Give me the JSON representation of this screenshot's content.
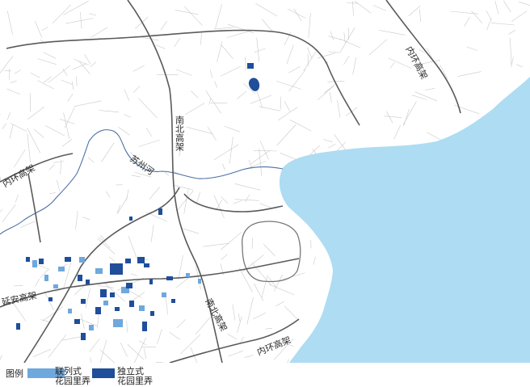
{
  "labels": {
    "inner_ring_ne": "内环高架",
    "inner_ring_w": "内环高架",
    "inner_ring_s": "内环高架",
    "north_south_n": "南北高架",
    "north_south_s": "南北高架",
    "yanan": "延安高架",
    "suzhou_creek": "苏州河"
  },
  "legend": {
    "title": "图例",
    "items": [
      {
        "line1": "联列式",
        "line2": "花园里弄",
        "color": "#6fa8dc"
      },
      {
        "line1": "独立式",
        "line2": "花园里弄",
        "color": "#1f4e9a"
      }
    ]
  },
  "colors": {
    "water": "#aedcf2",
    "background": "#ffffff",
    "street": "#c7c7c7",
    "expressway": "#555555",
    "river": "#4a6fa5",
    "semi_detached": "#6fa8dc",
    "detached": "#1f4e9a"
  }
}
